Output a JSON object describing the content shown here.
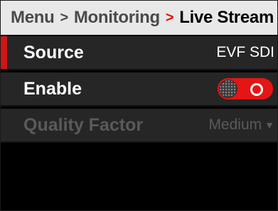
{
  "breadcrumb": {
    "items": [
      "Menu",
      "Monitoring"
    ],
    "current": "Live Stream",
    "separator": ">"
  },
  "settings": [
    {
      "label": "Source",
      "value": "EVF SDI",
      "selected": true,
      "enabled": true
    },
    {
      "label": "Enable",
      "control": "toggle",
      "state": "on",
      "enabled": true
    },
    {
      "label": "Quality Factor",
      "value": "Medium",
      "dropdown": true,
      "enabled": false
    }
  ],
  "colors": {
    "accent": "#e01010",
    "row_background": "#262626",
    "breadcrumb_background": "#e8e8e8",
    "disabled_text": "#5a5a5a"
  }
}
